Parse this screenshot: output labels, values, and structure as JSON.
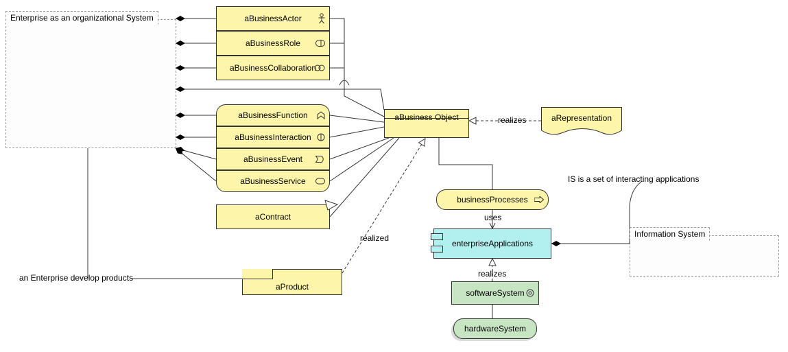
{
  "enterprise": {
    "label": "Enterprise as an organizational System",
    "products_note": "an Enterprise develop products"
  },
  "information_system": {
    "label": "Information System",
    "note": "IS is a set of interacting applications"
  },
  "elements": {
    "business_actor": "aBusinessActor",
    "business_role": "aBusinessRole",
    "business_collaboration": "aBusinessCollaboration",
    "business_function": "aBusinessFunction",
    "business_interaction": "aBusinessInteraction",
    "business_event": "aBusinessEvent",
    "business_service": "aBusinessService",
    "contract": "aContract",
    "product": "aProduct",
    "business_object": "aBusiness Object",
    "representation": "aRepresentation",
    "business_processes": "businessProcesses",
    "enterprise_applications": "enterpriseApplications",
    "software_system": "softwareSystem",
    "hardware_system": "hardwareSystem"
  },
  "edge_labels": {
    "realizes1": "realizes",
    "realized": "realized",
    "uses": "uses",
    "realizes2": "realizes"
  },
  "colors": {
    "yellow": "#fcf5aa",
    "cyan": "#b2f0f0",
    "green": "#c7e5c3"
  }
}
